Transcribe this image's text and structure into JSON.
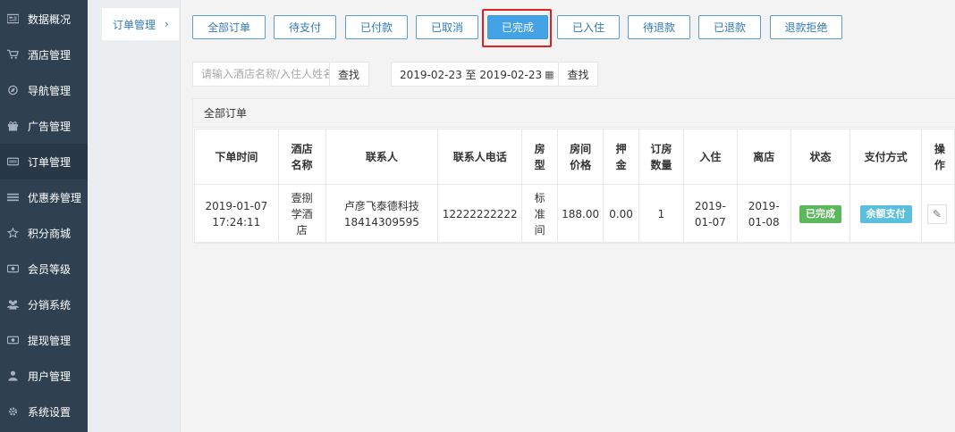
{
  "nav": {
    "items": [
      {
        "label": "数据概况",
        "icon": "dashboard-icon"
      },
      {
        "label": "酒店管理",
        "icon": "cart-icon"
      },
      {
        "label": "导航管理",
        "icon": "compass-icon"
      },
      {
        "label": "广告管理",
        "icon": "gift-icon"
      },
      {
        "label": "订单管理",
        "icon": "hdd-icon"
      },
      {
        "label": "优惠券管理",
        "icon": "list-icon"
      },
      {
        "label": "积分商城",
        "icon": "star-icon"
      },
      {
        "label": "会员等级",
        "icon": "money-icon"
      },
      {
        "label": "分销系统",
        "icon": "users-icon"
      },
      {
        "label": "提现管理",
        "icon": "cash-icon"
      },
      {
        "label": "用户管理",
        "icon": "user-icon"
      },
      {
        "label": "系统设置",
        "icon": "gear-icon"
      }
    ],
    "active_index": 4
  },
  "subnav": {
    "label": "订单管理",
    "chevron": "›"
  },
  "filters": [
    {
      "label": "全部订单"
    },
    {
      "label": "待支付"
    },
    {
      "label": "已付款"
    },
    {
      "label": "已取消"
    },
    {
      "label": "已完成"
    },
    {
      "label": "已入住"
    },
    {
      "label": "待退款"
    },
    {
      "label": "已退款"
    },
    {
      "label": "退款拒绝"
    }
  ],
  "active_filter_index": 4,
  "search": {
    "placeholder": "请输入酒店名称/入住人姓名",
    "button": "查找"
  },
  "date_range": {
    "value": "2019-02-23 至 2019-02-23",
    "button": "查找"
  },
  "panel": {
    "title": "全部订单"
  },
  "table": {
    "headers": [
      "下单时间",
      "酒店名称",
      "联系人",
      "联系人电话",
      "房型",
      "房间价格",
      "押金",
      "订房数量",
      "入住",
      "离店",
      "状态",
      "支付方式",
      "操作"
    ],
    "rows": [
      {
        "order_time_date": "2019-01-07",
        "order_time_clock": "17:24:11",
        "hotel_name": "壹捌学酒店",
        "contact_name": "卢彦飞泰德科技",
        "contact_mobile": "18414309595",
        "phone": "12222222222",
        "room_type": "标准间",
        "price": "188.00",
        "deposit": "0.00",
        "quantity": "1",
        "checkin": "2019-01-07",
        "checkout": "2019-01-08",
        "status": "已完成",
        "payment": "余额支付"
      }
    ]
  },
  "colors": {
    "nav_bg": "#2f4050",
    "active_filter": "#44a2e6",
    "highlight": "#e02121",
    "status_green": "#5cb85c",
    "payment_blue": "#5bc0de"
  }
}
